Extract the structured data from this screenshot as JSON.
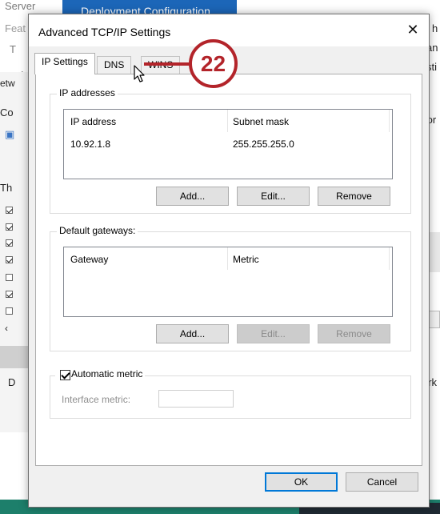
{
  "background": {
    "server_label": "Server",
    "feat_label": "Feat",
    "deployment_title": "Deployment Configuration",
    "frag_i": "T",
    "frag_in": "In",
    "frag_etw": "etw",
    "frag_co": "Co",
    "frag_th": "Th",
    "frag_d": "D",
    "right_h": "h",
    "right_an": "an e",
    "right_sti": "sti",
    "right_for": "for",
    "right_ork": "ork"
  },
  "dialog": {
    "title": "Advanced TCP/IP Settings",
    "close_glyph": "✕",
    "tabs": [
      {
        "label": "IP Settings",
        "active": true
      },
      {
        "label": "DNS",
        "active": false
      },
      {
        "label": "WINS",
        "active": false
      }
    ],
    "ip_addresses": {
      "group_label": "IP addresses",
      "columns": [
        "IP address",
        "Subnet mask"
      ],
      "rows": [
        {
          "ip": "10.92.1.8",
          "mask": "255.255.255.0"
        }
      ],
      "buttons": {
        "add": "Add...",
        "edit": "Edit...",
        "remove": "Remove"
      }
    },
    "default_gateways": {
      "group_label": "Default gateways:",
      "columns": [
        "Gateway",
        "Metric"
      ],
      "rows": [],
      "buttons": {
        "add": "Add...",
        "edit": "Edit...",
        "remove": "Remove"
      }
    },
    "automatic_metric": {
      "label": "Automatic metric",
      "checked": true,
      "interface_metric_label": "Interface metric:",
      "interface_metric_value": ""
    },
    "footer": {
      "ok": "OK",
      "cancel": "Cancel"
    }
  },
  "callout": {
    "number": "22",
    "color": "#b3242a"
  },
  "colors": {
    "accent": "#0078d7",
    "title_bar_blue": "#1c66b8"
  }
}
